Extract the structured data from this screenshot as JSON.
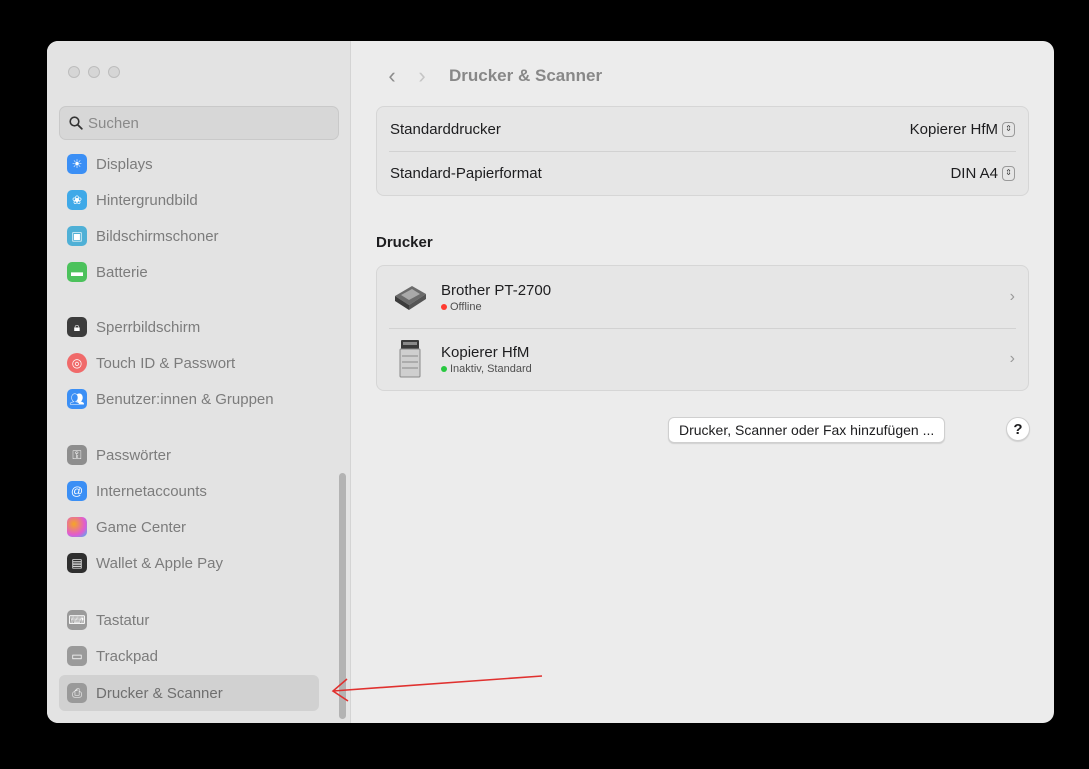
{
  "window": {
    "title": "Drucker & Scanner"
  },
  "search": {
    "placeholder": "Suchen"
  },
  "sidebar": {
    "items": [
      {
        "label": "Displays",
        "icon": "sun-icon",
        "color": "#3b8ff5"
      },
      {
        "label": "Hintergrundbild",
        "icon": "flower-icon",
        "color": "#3fa9e8"
      },
      {
        "label": "Bildschirmschoner",
        "icon": "screensaver-icon",
        "color": "#4fb0d6"
      },
      {
        "label": "Batterie",
        "icon": "battery-icon",
        "color": "#4cc25c"
      },
      {
        "label": "Sperrbildschirm",
        "icon": "lock-icon",
        "color": "#3c3c3c"
      },
      {
        "label": "Touch ID & Passwort",
        "icon": "fingerprint-icon",
        "color": "#f06a6a"
      },
      {
        "label": "Benutzer:innen & Gruppen",
        "icon": "users-icon",
        "color": "#3b8ff5"
      },
      {
        "label": "Passwörter",
        "icon": "key-icon",
        "color": "#8e8e8e"
      },
      {
        "label": "Internetaccounts",
        "icon": "at-icon",
        "color": "#3b8ff5"
      },
      {
        "label": "Game Center",
        "icon": "game-center-icon",
        "color": "#f5a623"
      },
      {
        "label": "Wallet & Apple Pay",
        "icon": "wallet-icon",
        "color": "#2f2f2f"
      },
      {
        "label": "Tastatur",
        "icon": "keyboard-icon",
        "color": "#9a9a9a"
      },
      {
        "label": "Trackpad",
        "icon": "trackpad-icon",
        "color": "#9a9a9a"
      },
      {
        "label": "Drucker & Scanner",
        "icon": "printer-icon",
        "color": "#9a9a9a"
      }
    ]
  },
  "settings": {
    "default_printer_label": "Standarddrucker",
    "default_printer_value": "Kopierer HfM",
    "paper_format_label": "Standard-Papierformat",
    "paper_format_value": "DIN A4"
  },
  "printers": {
    "section_title": "Drucker",
    "items": [
      {
        "name": "Brother PT-2700",
        "status": "Offline",
        "status_color": "#ff3b30"
      },
      {
        "name": "Kopierer HfM",
        "status": "Inaktiv, Standard",
        "status_color": "#28c840"
      }
    ]
  },
  "actions": {
    "add_button": "Drucker, Scanner oder Fax hinzufügen ...",
    "help": "?"
  },
  "colors": {
    "annotation_arrow": "#e0312f"
  }
}
